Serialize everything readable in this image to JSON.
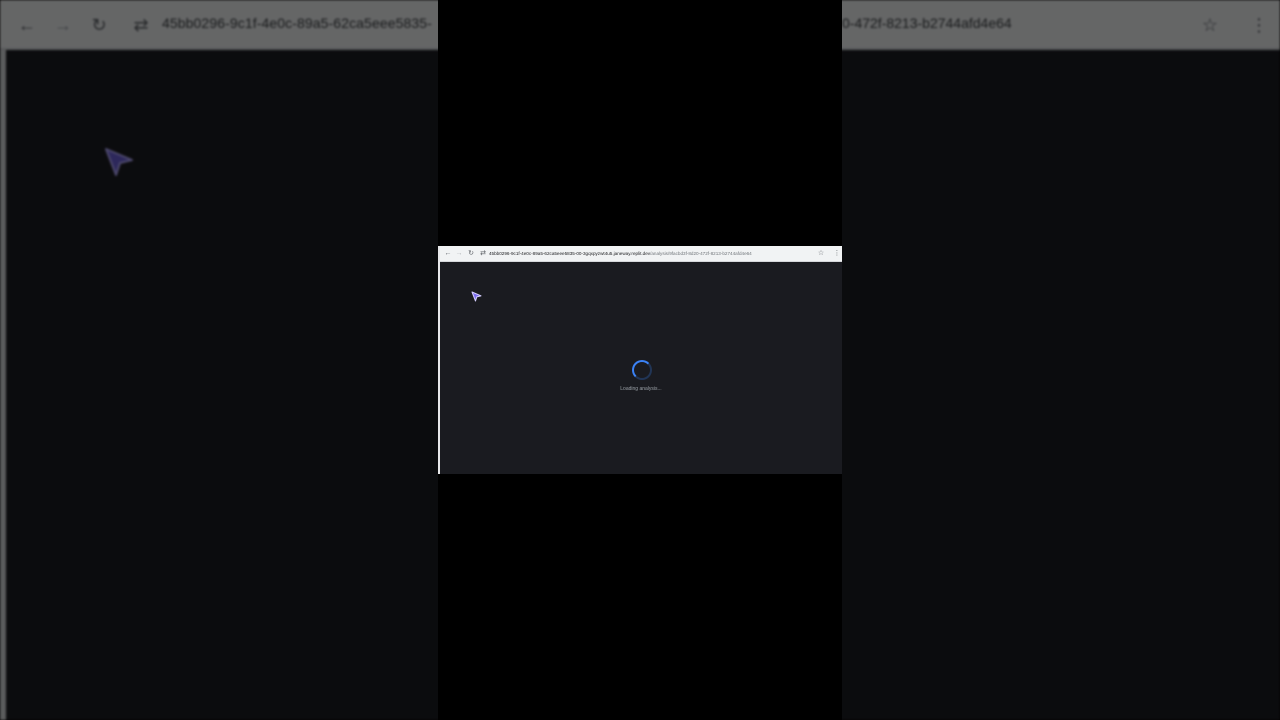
{
  "browser": {
    "url_host": "45bb0296-9c1f-4e0c-89a5-62ca5eee5835-00-3gqxpyzwt4u5.janeway.replit.dev",
    "url_path": "/analysis/9facbd3f-8d20-472f-8213-b2744afd4e64",
    "backdrop_url_left": "45bb0296-9c1f-4e0c-89a5-62ca5eee5835-",
    "backdrop_url_right": "0-472f-8213-b2744afd4e64",
    "icons": {
      "back": "back-arrow-icon",
      "forward": "forward-arrow-icon",
      "reload": "reload-icon",
      "site_settings": "tune-icon",
      "bookmark": "star-icon",
      "menu": "kebab-menu-icon"
    }
  },
  "main": {
    "loading_text": "Loading analysis...",
    "spinner_color": "#3b82f6"
  },
  "colors": {
    "content_bg": "#1a1b20",
    "toolbar_bg": "#f1f3f4",
    "cursor": "#7c6cf0"
  }
}
